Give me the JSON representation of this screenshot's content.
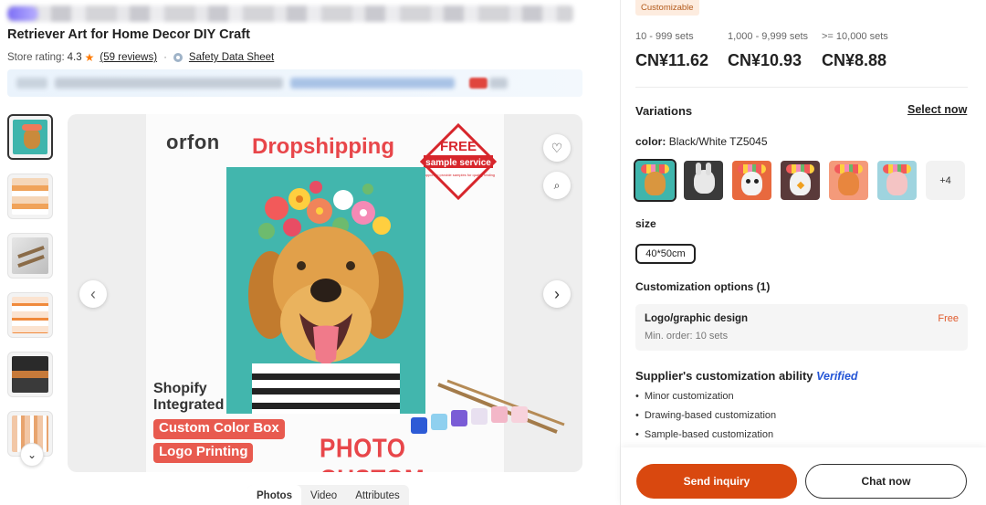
{
  "product": {
    "title": "Retriever Art for Home Decor DIY Craft",
    "store_rating_label": "Store rating:",
    "store_rating_value": "4.3",
    "reviews": "(59 reviews)",
    "safety_data_sheet": "Safety Data Sheet"
  },
  "media": {
    "brand": "orfon",
    "dropshipping": "Dropshipping",
    "free_badge": {
      "top": "FREE",
      "middle": "sample service",
      "bottom": "Support to provide samples for quality testing"
    },
    "shopify_line1": "Shopify",
    "shopify_line2": "Integrated",
    "custom_color_box": "Custom Color Box",
    "logo_printing": "Logo Printing",
    "photo_custom": "PHOTO CUSTOM",
    "tabs": [
      "Photos",
      "Video",
      "Attributes"
    ],
    "active_tab": "Photos"
  },
  "pricing": {
    "customizable_tag": "Customizable",
    "tiers": [
      {
        "range": "10 - 999 sets",
        "price": "CN¥11.62"
      },
      {
        "range": "1,000 - 9,999 sets",
        "price": "CN¥10.93"
      },
      {
        "range": ">= 10,000 sets",
        "price": "CN¥8.88"
      }
    ]
  },
  "variations": {
    "title": "Variations",
    "select_now": "Select now",
    "color_label": "color:",
    "color_value": "Black/White TZ5045",
    "more_colors": "+4",
    "size_label": "size",
    "size_value": "40*50cm"
  },
  "customization": {
    "title": "Customization options (1)",
    "option_name": "Logo/graphic design",
    "option_min_order": "Min. order: 10 sets",
    "option_price": "Free"
  },
  "supplier_ability": {
    "title": "Supplier's customization ability",
    "verified": "Verified",
    "items": [
      "Minor customization",
      "Drawing-based customization",
      "Sample-based customization"
    ]
  },
  "actions": {
    "send_inquiry": "Send inquiry",
    "chat_now": "Chat now"
  }
}
